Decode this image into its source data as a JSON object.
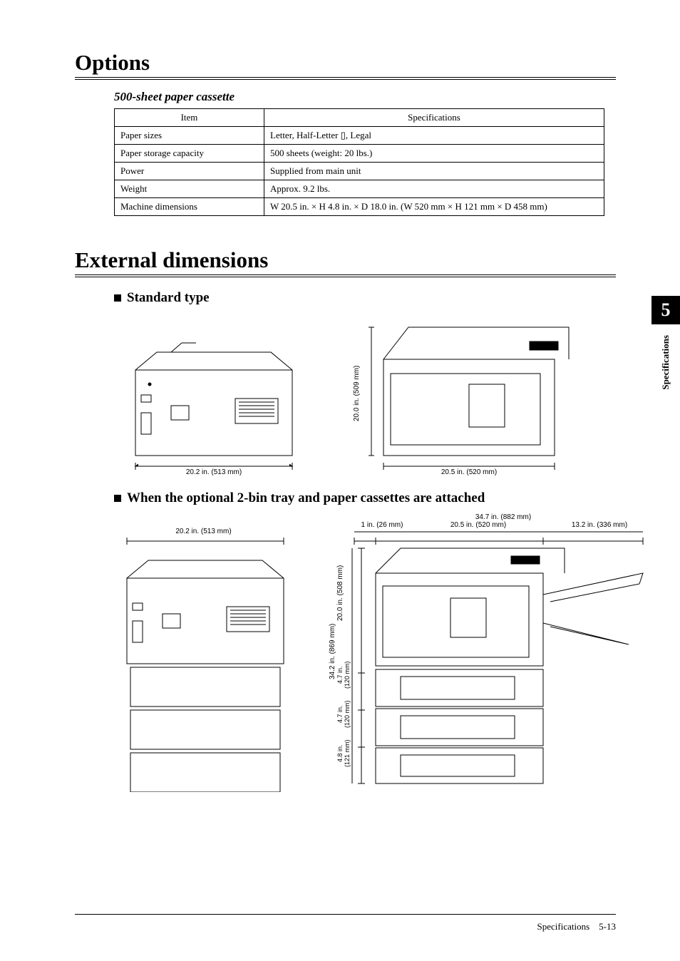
{
  "options_heading": "Options",
  "cassette_subtitle": "500-sheet paper cassette",
  "table": {
    "headers": {
      "item": "Item",
      "spec": "Specifications"
    },
    "rows": [
      {
        "item": "Paper sizes",
        "spec": "Letter, Half-Letter ▯, Legal"
      },
      {
        "item": "Paper storage capacity",
        "spec": "500 sheets (weight: 20 lbs.)"
      },
      {
        "item": "Power",
        "spec": "Supplied from main unit"
      },
      {
        "item": "Weight",
        "spec": "Approx. 9.2 lbs."
      },
      {
        "item": "Machine dimensions",
        "spec": "W 20.5 in. × H 4.8 in. × D 18.0 in. (W 520 mm × H 121 mm × D 458 mm)"
      }
    ]
  },
  "external_heading": "External dimensions",
  "standard_heading": "Standard type",
  "optional_heading": "When the optional 2-bin tray and paper cassettes are attached",
  "dims": {
    "std_front_w": "20.2 in. (513 mm)",
    "std_side_h": "20.0 in. (509 mm)",
    "std_side_w": "20.5 in. (520 mm)",
    "opt_front_w": "20.2 in. (513 mm)",
    "opt_total_w": "34.7 in. (882 mm)",
    "opt_1in": "1 in. (26 mm)",
    "opt_520": "20.5 in. (520 mm)",
    "opt_336": "13.2 in. (336 mm)",
    "opt_total_h": "34.2 in. (869 mm)",
    "opt_508": "20.0 in. (508 mm)",
    "opt_120a": "4.7 in.\n(120 mm)",
    "opt_120b": "4.7 in.\n(120 mm)",
    "opt_121": "4.8 in.\n(121 mm)"
  },
  "side": {
    "page": "5",
    "label": "Specifications"
  },
  "footer": {
    "chapter": "Specifications",
    "page": "5-13"
  }
}
